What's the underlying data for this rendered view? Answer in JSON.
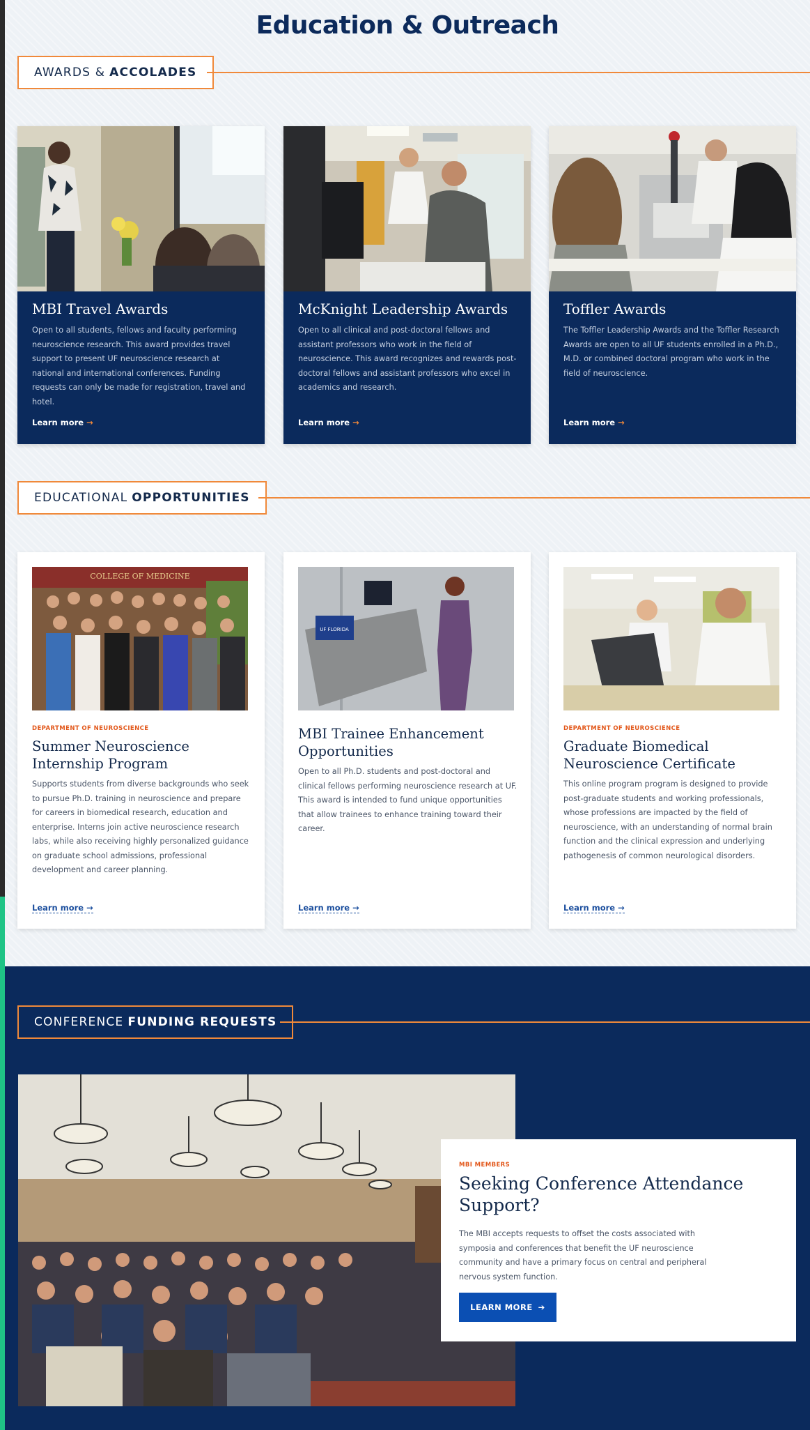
{
  "page": {
    "title": "Education & Outreach"
  },
  "sections": {
    "awards": {
      "label_plain": "AWARDS &",
      "label_bold": "ACCOLADES"
    },
    "educational": {
      "label_plain": "EDUCATIONAL",
      "label_bold": "OPPORTUNITIES"
    },
    "conference": {
      "label_plain": "CONFERENCE",
      "label_bold": "FUNDING REQUESTS"
    }
  },
  "awards": [
    {
      "title": "MBI Travel Awards",
      "text": "Open to all students, fellows and faculty performing neuroscience research. This award provides travel support to present UF neuroscience research at national and international conferences. Funding requests can only be made for registration, travel and hotel.",
      "link": "Learn more",
      "image": "presenter-photo"
    },
    {
      "title": "McKnight Leadership Awards",
      "text": "Open to all clinical and post-doctoral fellows and assistant professors who work in the field of neuroscience. This award recognizes and rewards post-doctoral fellows and assistant professors who excel in academics and research.",
      "link": "Learn more",
      "image": "lab-computer-photo"
    },
    {
      "title": "Toffler Awards",
      "text": "The Toffler Leadership Awards and the Toffler Research Awards are open to all UF students enrolled in a Ph.D., M.D. or combined doctoral program who work in the field of neuroscience.",
      "link": "Learn more",
      "image": "microscope-photo"
    }
  ],
  "opportunities": [
    {
      "dept": "DEPARTMENT OF NEUROSCIENCE",
      "title": "Summer Neuroscience Internship Program",
      "text": "Supports students from diverse backgrounds who seek to pursue Ph.D. training in neuroscience and prepare for careers in biomedical research, education and enterprise. Interns join active neuroscience research labs, while also receiving highly personalized guidance on graduate school admissions, professional development and career planning.",
      "link": "Learn more",
      "image_sign": "COLLEGE OF MEDICINE"
    },
    {
      "dept": "",
      "title": "MBI Trainee Enhancement Opportunities",
      "text": "Open to all Ph.D. students and post-doctoral and clinical fellows performing neuroscience research at UF. This award is intended to fund unique opportunities that allow trainees to enhance training toward their career.",
      "link": "Learn more",
      "image_sign": "UF FLORIDA"
    },
    {
      "dept": "DEPARTMENT OF NEUROSCIENCE",
      "title": "Graduate Biomedical Neuroscience Certificate",
      "text": "This online program program is designed to provide post-graduate students and working professionals, whose professions are impacted by the field of neuroscience, with an understanding of normal brain function and the clinical expression and underlying pathogenesis of common neurological disorders.",
      "link": "Learn more",
      "image_sign": ""
    }
  ],
  "conference": {
    "kicker": "MBI MEMBERS",
    "title": "Seeking Conference Attendance Support?",
    "text": "The MBI accepts requests to offset the costs associated with symposia and conferences that benefit the UF neuroscience community and have a primary focus on central and peripheral nervous system function.",
    "button": "LEARN MORE"
  },
  "icons": {
    "arrow": "arrow-right-icon"
  },
  "colors": {
    "navy": "#0b2a5c",
    "orange": "#f0893a",
    "blue_button": "#0b4fb3",
    "kicker_orange": "#e2571a"
  }
}
